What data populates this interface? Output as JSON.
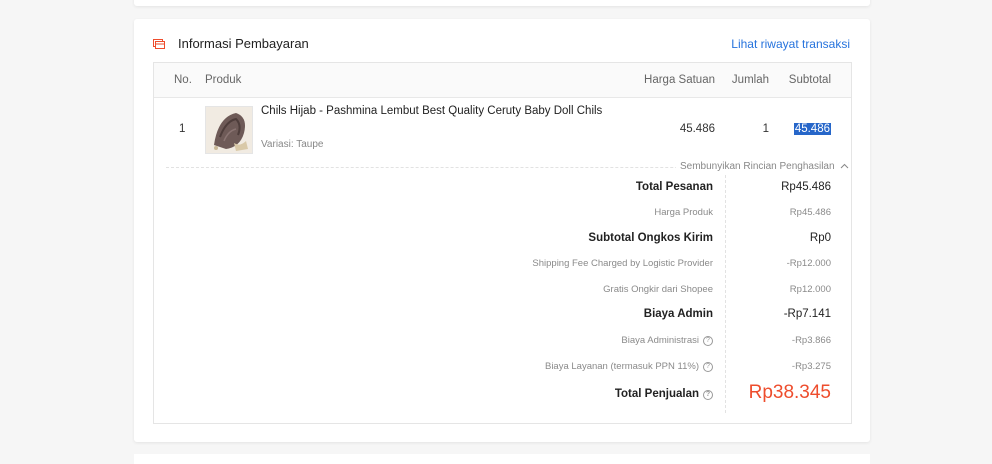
{
  "header": {
    "title": "Informasi Pembayaran",
    "link": "Lihat riwayat transaksi",
    "icon": "payment-card-icon"
  },
  "table": {
    "columns": [
      "No.",
      "Produk",
      "Harga Satuan",
      "Jumlah",
      "Subtotal"
    ],
    "rows": [
      {
        "no": "1",
        "product_name": "Chils Hijab - Pashmina Lembut Best Quality Ceruty Baby Doll Chils",
        "variant": "Variasi: Taupe",
        "unit_price": "45.486",
        "quantity": "1",
        "subtotal": "45.486"
      }
    ]
  },
  "breakdown": {
    "toggle_label": "Sembunyikan Rincian Penghasilan",
    "total_pesanan": {
      "label": "Total Pesanan",
      "value": "Rp45.486"
    },
    "harga_produk": {
      "label": "Harga Produk",
      "value": "Rp45.486"
    },
    "subtotal_ongkir": {
      "label": "Subtotal Ongkos Kirim",
      "value": "Rp0"
    },
    "shipping_fee": {
      "label": "Shipping Fee Charged by Logistic Provider",
      "value": "-Rp12.000"
    },
    "gratis_ongkir": {
      "label": "Gratis Ongkir dari Shopee",
      "value": "Rp12.000"
    },
    "biaya_admin": {
      "label": "Biaya Admin",
      "value": "-Rp7.141"
    },
    "biaya_administrasi": {
      "label": "Biaya Administrasi",
      "value": "-Rp3.866"
    },
    "biaya_layanan": {
      "label": "Biaya Layanan (termasuk PPN 11%)",
      "value": "-Rp3.275"
    },
    "total_penjualan": {
      "label": "Total Penjualan",
      "value": "Rp38.345"
    }
  },
  "colors": {
    "accent_link": "#2673dd",
    "total_highlight": "#ee4d2d",
    "selection": "#2666c9"
  }
}
